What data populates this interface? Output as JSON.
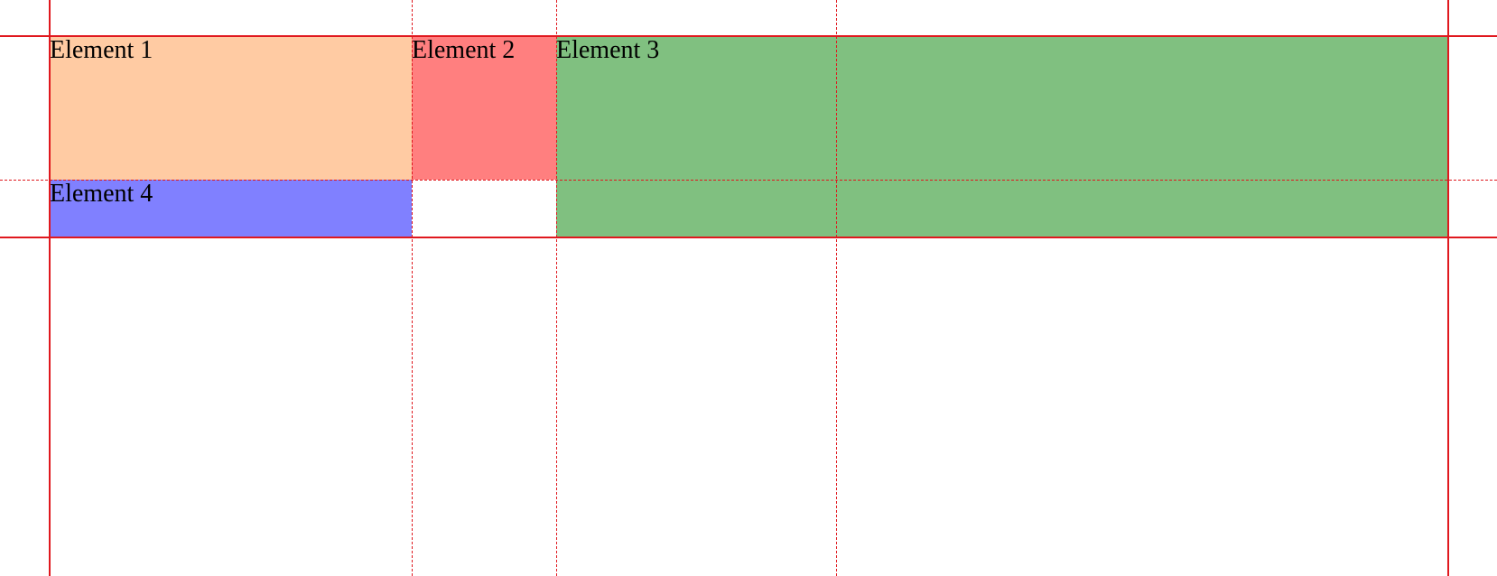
{
  "elements": [
    {
      "id": "element-1",
      "label": "Element 1",
      "color": "#ffcba3"
    },
    {
      "id": "element-2",
      "label": "Element 2",
      "color": "#ff7f7f"
    },
    {
      "id": "element-3",
      "label": "Element 3",
      "color": "#80c080"
    },
    {
      "id": "element-4",
      "label": "Element 4",
      "color": "#8080ff"
    }
  ],
  "grid_colors": {
    "solid": "#e0181e",
    "dashed": "#e0181e"
  }
}
